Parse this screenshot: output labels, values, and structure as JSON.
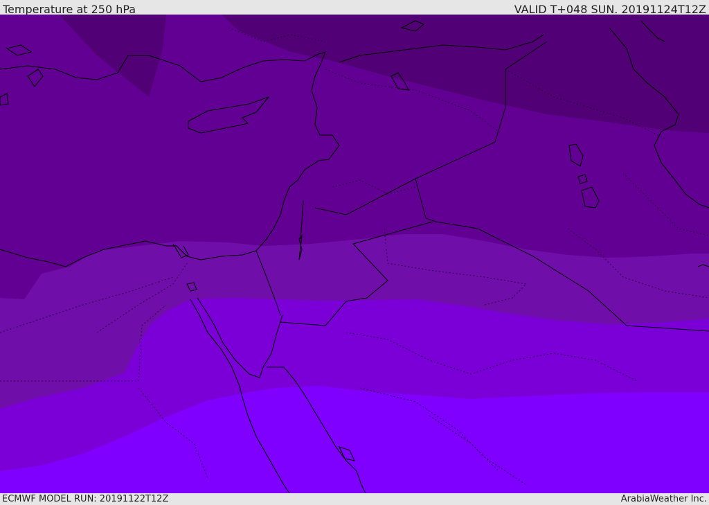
{
  "header": {
    "title": "Temperature at 250 hPa",
    "valid": "VALID T+048 SUN. 20191124T12Z"
  },
  "footer": {
    "model_run": "ECMWF MODEL RUN: 20191122T12Z",
    "credit": "ArabiaWeather Inc."
  },
  "colors": {
    "band_darkest": "#520075",
    "band_dark": "#620093",
    "band_mid": "#6f0ea8",
    "band_bright": "#7b00d8",
    "band_brightest": "#7f00ff",
    "coastline": "#000000",
    "frame": "#e6e6e6"
  }
}
